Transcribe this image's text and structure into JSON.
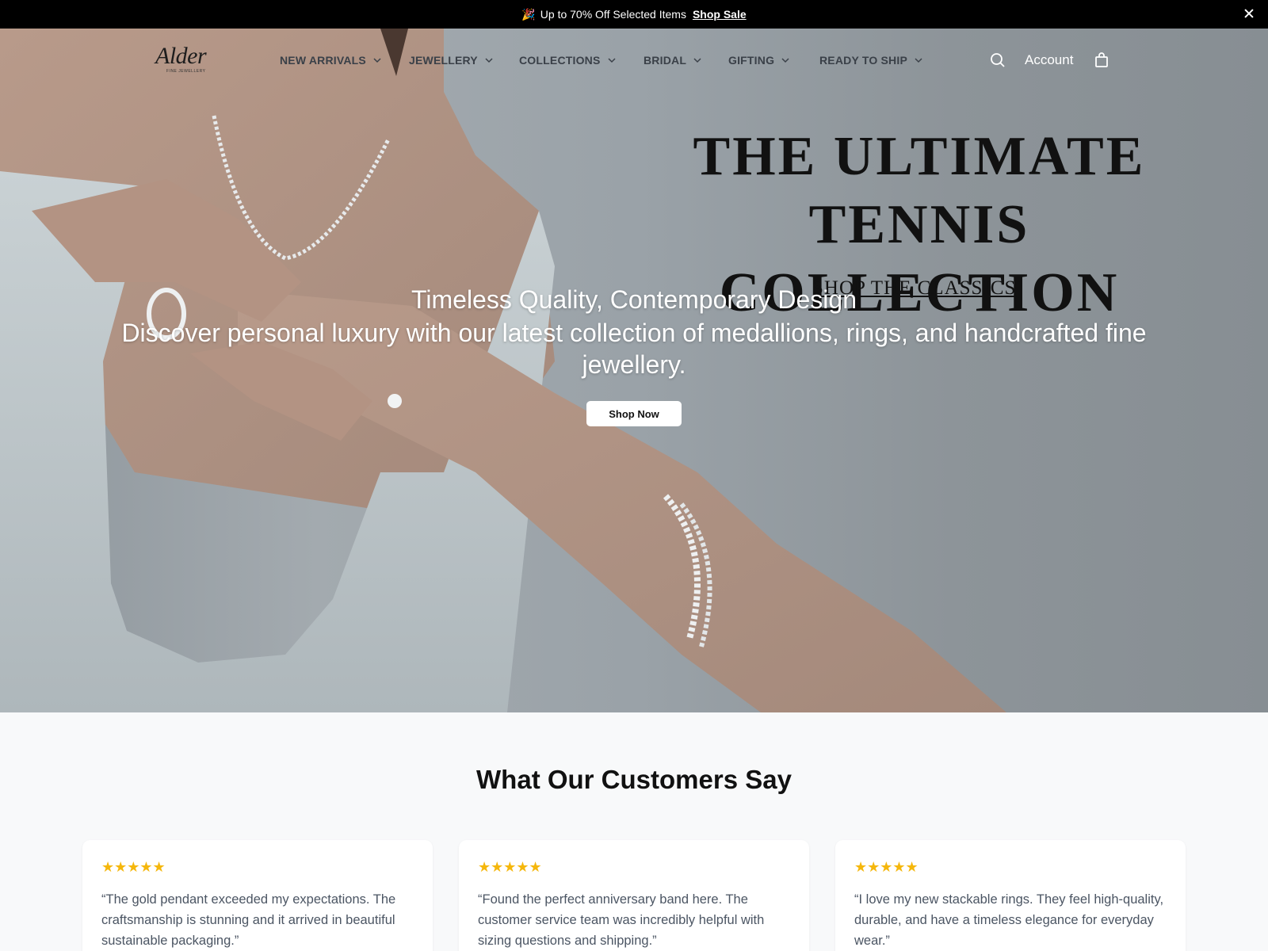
{
  "announcement": {
    "emoji": "🎉",
    "text": "Up to 70% Off Selected Items",
    "link": "Shop Sale"
  },
  "nav": {
    "logo_text": "Alder",
    "logo_subtext": "FINE JEWELLERY",
    "items": [
      {
        "label": "NEW ARRIVALS"
      },
      {
        "label": "JEWELLERY"
      },
      {
        "label": "COLLECTIONS"
      },
      {
        "label": "BRIDAL"
      },
      {
        "label": "GIFTING"
      },
      {
        "label": "READY TO SHIP"
      }
    ],
    "account_label": "Account",
    "icons": [
      "search-icon",
      "bag-icon",
      "chevron-down-icon",
      "close-icon"
    ]
  },
  "hero": {
    "title_line1": "THE ULTIMATE",
    "title_line2": "TENNIS COLLECTION",
    "classics_link": "SHOP THE CLASSICS",
    "subtitle": "Timeless Quality, Contemporary Design",
    "description": "Discover personal luxury with our latest collection of medallions, rings, and handcrafted fine jewellery.",
    "cta": "Shop Now"
  },
  "reviews": {
    "title": "What Our Customers Say",
    "cards": [
      {
        "stars": "★★★★★",
        "rating": 5,
        "quote": "“The gold pendant exceeded my expectations. The craftsmanship is stunning and it arrived in beautiful sustainable packaging.”"
      },
      {
        "stars": "★★★★★",
        "rating": 5,
        "quote": "“Found the perfect anniversary band here. The customer service team was incredibly helpful with sizing questions and shipping.”"
      },
      {
        "stars": "★★★★★",
        "rating": 5,
        "quote": "“I love my new stackable rings. They feel high-quality, durable, and have a timeless elegance for everyday wear.”"
      }
    ]
  },
  "colors": {
    "announcement_bg": "#000000",
    "star": "#f5b70c",
    "page_bg": "#f8f9fa"
  }
}
